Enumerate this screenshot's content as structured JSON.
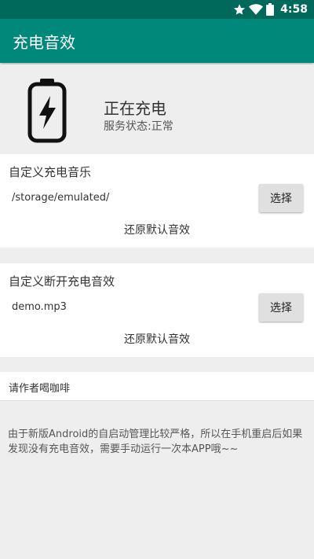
{
  "status_bar": {
    "time": "4:58",
    "icons": [
      "star-icon",
      "wifi-icon",
      "battery-icon"
    ]
  },
  "app_bar": {
    "title": "充电音效"
  },
  "status": {
    "charging_text": "正在充电",
    "service_status": "服务状态:正常",
    "icon": "battery-charging-icon"
  },
  "custom_charge_sound": {
    "title": "自定义充电音乐",
    "value": "/storage/emulated/",
    "select_label": "选择",
    "restore_label": "还原默认音效"
  },
  "custom_disconnect_sound": {
    "title": "自定义断开充电音效",
    "value": "demo.mp3",
    "select_label": "选择",
    "restore_label": "还原默认音效"
  },
  "coffee": {
    "label": "请作者喝咖啡"
  },
  "notice": {
    "text": "由于新版Android的自启动管理比较严格，所以在手机重启后如果发现没有充电音效，需要手动运行一次本APP哦~~"
  },
  "colors": {
    "status_bar": "#00695c",
    "app_bar": "#00897b",
    "background": "#eeeeee",
    "button": "#e0e0e0"
  }
}
